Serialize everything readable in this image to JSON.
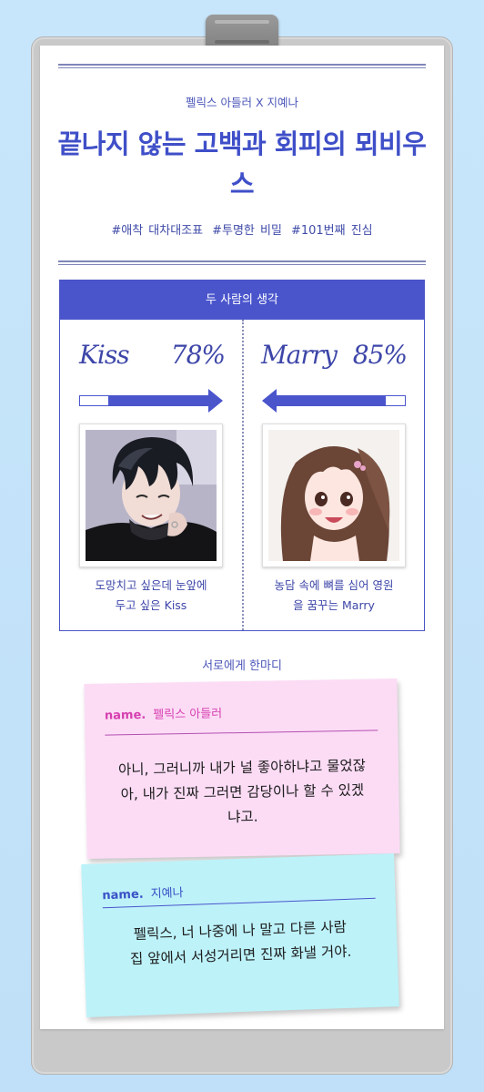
{
  "header": {
    "subtitle": "펠릭스 아들러 X 지예나",
    "title": "끝나지 않는 고백과 회피의 뫼비우스",
    "tags": [
      "#애착 대차대조표",
      "#투명한 비밀",
      "#101번째 진심"
    ]
  },
  "thoughts": {
    "header": "두 사람의 생각",
    "left": {
      "word": "Kiss",
      "percent": "78%",
      "level": 0.78,
      "caption_line1": "도망치고 싶은데 눈앞에",
      "caption_line2": "두고 싶은 Kiss",
      "portrait_icon": "dark-haired-man-portrait"
    },
    "right": {
      "word": "Marry",
      "percent": "85%",
      "level": 0.85,
      "caption_line1": "농담 속에 뼈를 심어 영원",
      "caption_line2": "을 꿈꾸는 Marry",
      "portrait_icon": "brown-haired-woman-portrait"
    }
  },
  "messages": {
    "header": "서로에게 한마디",
    "notes": [
      {
        "name_label": "name.",
        "name": "펠릭스 아들러",
        "line1": "아니, 그러니까 내가 널 좋아하냐고 물었잖",
        "line2": "아, 내가 진짜 그러면 감당이나 할 수 있겠",
        "line3": "냐고."
      },
      {
        "name_label": "name.",
        "name": "지예나",
        "line1": "펠릭스, 너 나중에 나 말고 다른 사람",
        "line2": "집 앞에서 서성거리면 진짜 화낼 거야."
      }
    ]
  },
  "colors": {
    "accent": "#4a55cc",
    "note_pink": "#fcdcf5",
    "note_cyan": "#bdf2f9",
    "background": "#c8e6fb"
  }
}
